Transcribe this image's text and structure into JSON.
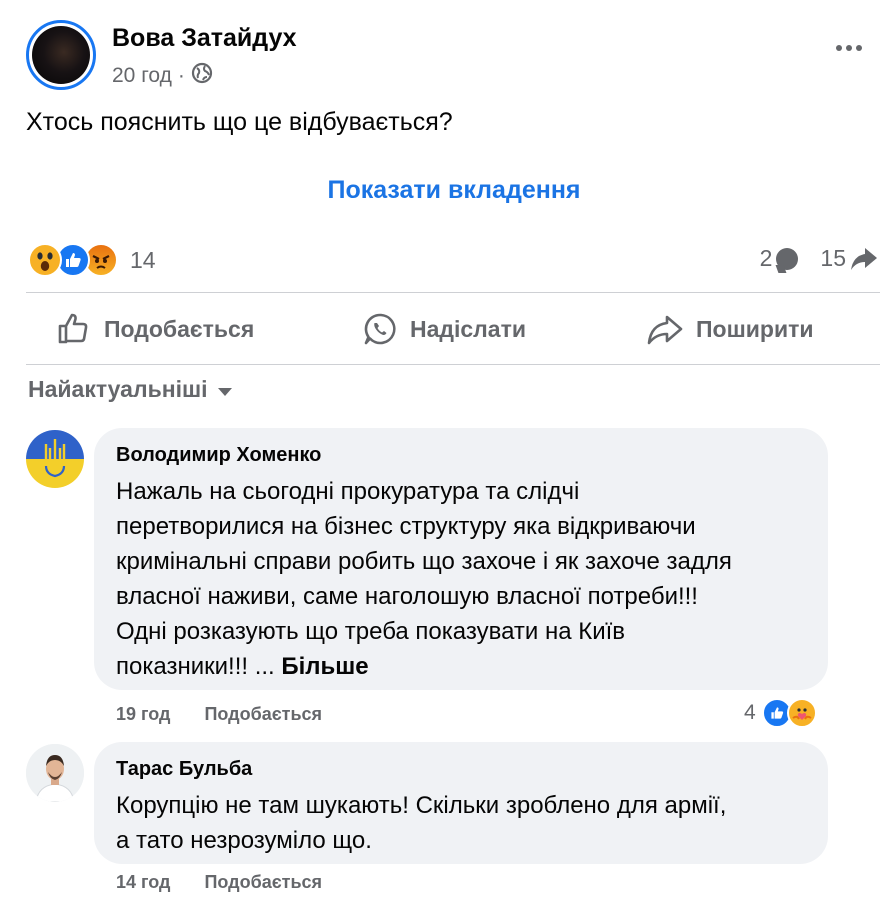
{
  "post": {
    "author": "Вова Затайдух",
    "time": "20 год",
    "separator": "·",
    "audience_icon": "globe-icon",
    "text": "Хтось пояснить що це відбувається?",
    "show_attachment": "Показати вкладення"
  },
  "reactions": {
    "icons": [
      "wow-icon",
      "like-icon",
      "angry-icon"
    ],
    "count": "14",
    "comments_count": "2",
    "shares_count": "15"
  },
  "actions": {
    "like": "Подобається",
    "send": "Надіслати",
    "share": "Поширити"
  },
  "sort": {
    "label": "Найактуальніші"
  },
  "comments": [
    {
      "name": "Володимир Хоменко",
      "lines": [
        "Нажаль на сьогодні прокуратура та слідчі",
        "перетворилися на бізнес структуру яка відкриваючи",
        "кримінальні справи робить що захоче і як захоче задля",
        "власної наживи, саме наголошую власної потреби!!!",
        "Одні розказують що треба показувати на Київ",
        "показники!!! ..."
      ],
      "more": "Більше",
      "time": "19 год",
      "like": "Подобається",
      "reaction_count": "4",
      "reaction_icons": [
        "like-icon",
        "care-icon"
      ]
    },
    {
      "name": "Тарас Бульба",
      "lines": [
        "Корупцію не там шукають! Скільки зроблено для армії,",
        "а тато незрозуміло що."
      ],
      "time": "14 год",
      "like": "Подобається"
    }
  ],
  "colors": {
    "accent": "#1877f2",
    "link": "#1b74e4",
    "secondary_text": "#65676b",
    "bubble_bg": "#f0f2f5"
  }
}
